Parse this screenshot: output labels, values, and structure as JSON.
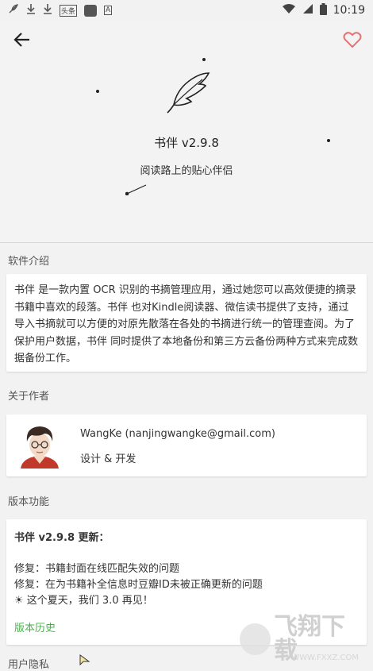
{
  "status_bar": {
    "time": "10:19",
    "small_label": "头条",
    "a_label": "A",
    "icons": [
      "feather-icon",
      "download-icon",
      "download-icon",
      "toutiao-icon",
      "square-icon",
      "a-icon",
      "wifi-icon",
      "signal-icon",
      "battery-icon"
    ]
  },
  "header": {
    "back_icon": "arrow-left-icon",
    "favorite_icon": "heart-outline-icon",
    "favorite_color": "#e57373"
  },
  "app": {
    "title": "书伴  v2.9.8",
    "slogan": "阅读路上的贴心伴侣",
    "logo_icon": "quill-feather-icon"
  },
  "intro": {
    "label": "软件介绍",
    "text": "书伴 是一款内置 OCR 识别的书摘管理应用，通过她您可以高效便捷的摘录书籍中喜欢的段落。书伴 也对Kindle阅读器、微信读书提供了支持，通过导入书摘就可以方便的对原先散落在各处的书摘进行统一的管理查阅。为了保护用户数据，书伴 同时提供了本地备份和第三方云备份两种方式来完成数据备份工作。"
  },
  "author": {
    "label": "关于作者",
    "name": "WangKe (nanjingwangke@gmail.com)",
    "role": "设计 & 开发"
  },
  "version": {
    "label": "版本功能",
    "heading": "书伴  v2.9.8 更新：",
    "lines": [
      "修复：书籍封面在线匹配失效的问题",
      "修复：在为书籍补全信息时豆瓣ID未被正确更新的问题",
      "☀ 这个夏天，我们 3.0 再见！"
    ],
    "history_link": "版本历史",
    "accent": "#4caf50"
  },
  "privacy": {
    "label": "用户隐私"
  },
  "watermark": {
    "main": "飞翔下载",
    "sub": "WWW.FXXZ.COM"
  }
}
